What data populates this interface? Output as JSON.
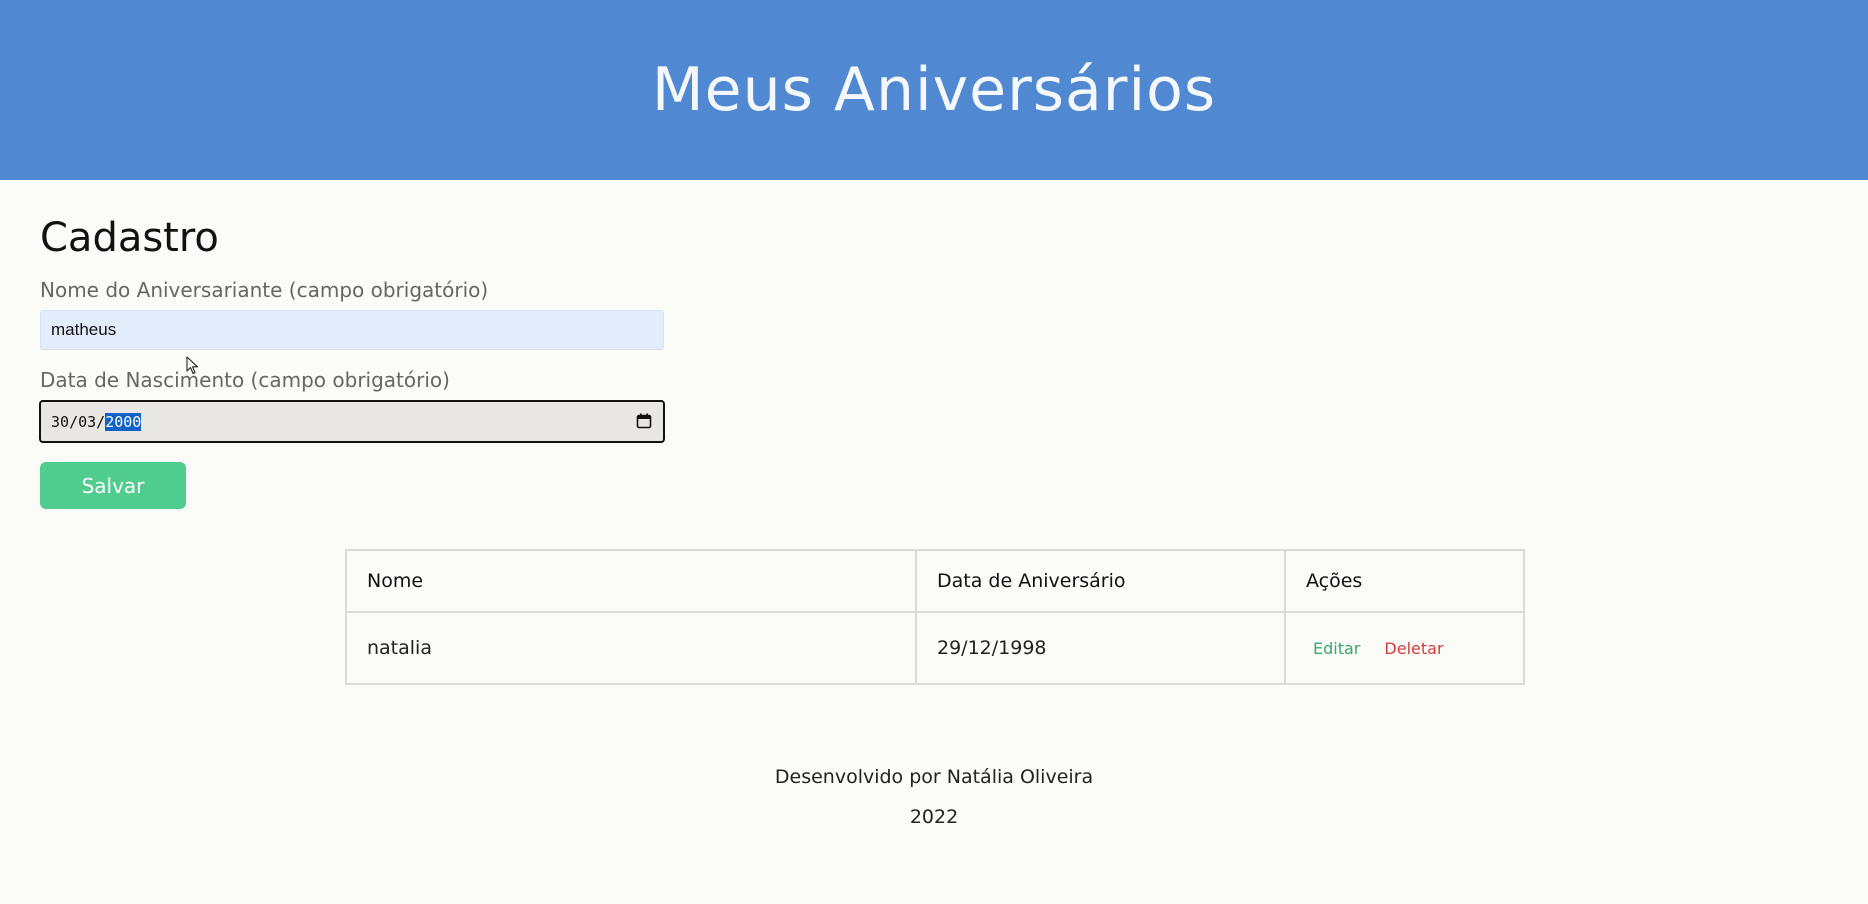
{
  "header": {
    "title": "Meus Aniversários"
  },
  "form": {
    "title": "Cadastro",
    "name_label": "Nome do Aniversariante (campo obrigatório)",
    "name_value": "matheus",
    "date_label": "Data de Nascimento (campo obrigatório)",
    "date_day": "30",
    "date_month": "03",
    "date_year": "2000",
    "date_separator": "/",
    "save_label": "Salvar"
  },
  "table": {
    "headers": [
      "Nome",
      "Data de Aniversário",
      "Ações"
    ],
    "rows": [
      {
        "name": "natalia",
        "date": "29/12/1998",
        "edit_label": "Editar",
        "delete_label": "Deletar"
      }
    ]
  },
  "footer": {
    "credit": "Desenvolvido por Natália Oliveira",
    "year": "2022"
  },
  "colors": {
    "header_bg": "#5089d2",
    "save_button": "#50cc8e",
    "edit_link": "#38a86c",
    "delete_link": "#d23c3c",
    "selection": "#0f63c8"
  },
  "icons": {
    "date_picker": "calendar-icon",
    "pointer": "mouse-cursor-icon"
  }
}
